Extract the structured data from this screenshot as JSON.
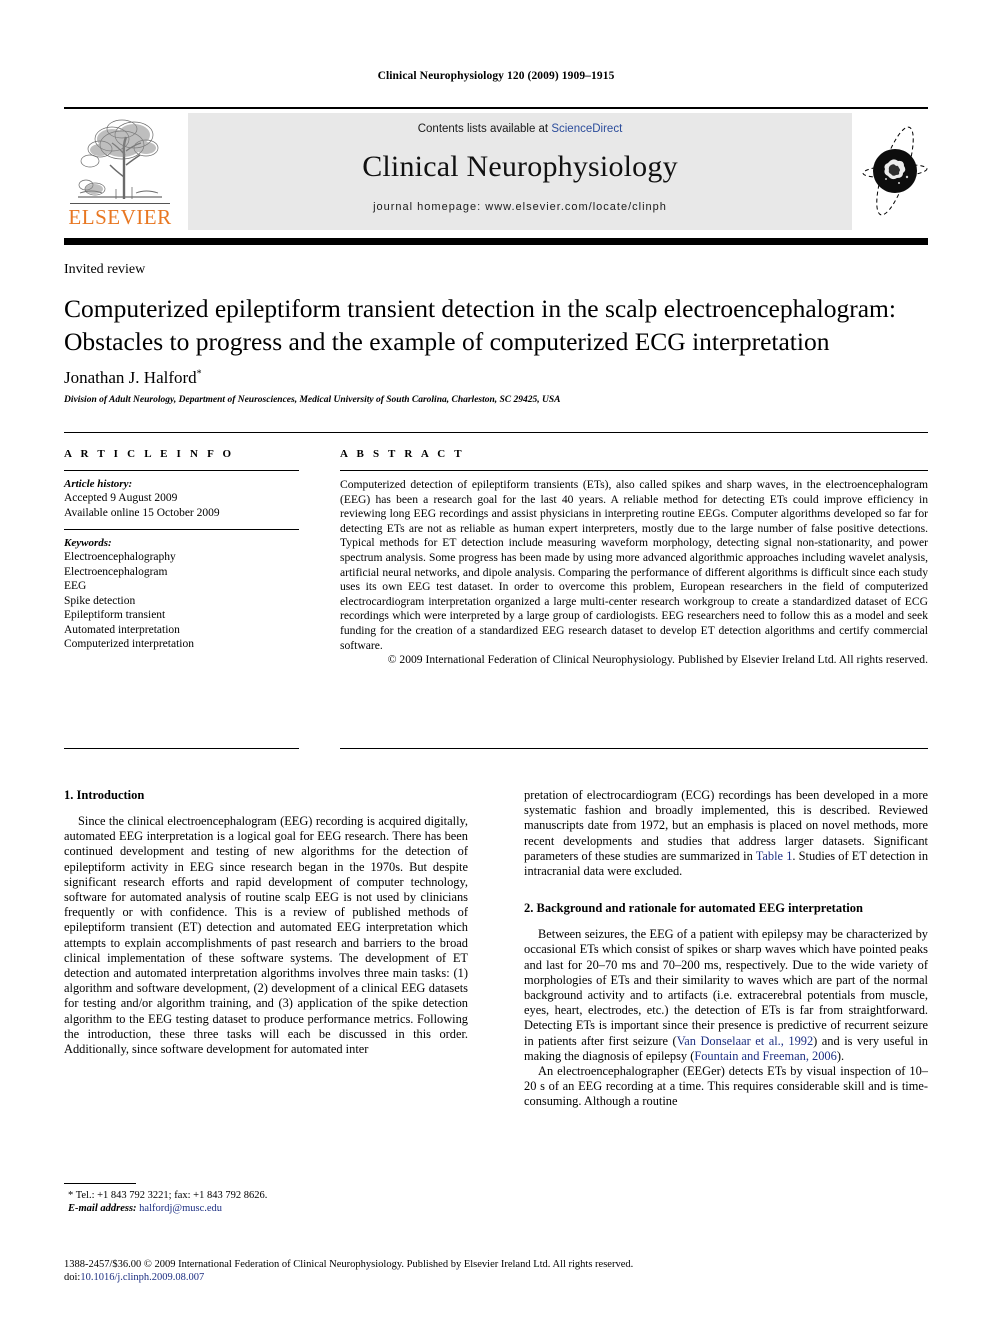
{
  "running_head": "Clinical Neurophysiology 120 (2009) 1909–1915",
  "masthead": {
    "contents_prefix": "Contents lists available at ",
    "sciencedirect_label": "ScienceDirect",
    "journal_title": "Clinical Neurophysiology",
    "homepage_line": "journal homepage: www.elsevier.com/locate/clinph",
    "elsevier_wordmark": "ELSEVIER",
    "tree_logo_name": "elsevier-tree-logo",
    "journal_mark_name": "clinical-neurophysiology-emblem",
    "sciencedirect_color": "#2b4c9b",
    "elsevier_orange": "#E87722",
    "header_box_bg": "#e8e8e8"
  },
  "article": {
    "type_label": "Invited review",
    "title": "Computerized epileptiform transient detection in the scalp electroencephalogram: Obstacles to progress and the example of computerized ECG interpretation",
    "author": "Jonathan J. Halford",
    "author_marker": "*",
    "affiliation": "Division of Adult Neurology, Department of Neurosciences, Medical University of South Carolina, Charleston, SC 29425, USA"
  },
  "info": {
    "heading": "A R T I C L E   I N F O",
    "history_label": "Article history:",
    "history_lines": [
      "Accepted 9 August 2009",
      "Available online 15 October 2009"
    ],
    "keywords_label": "Keywords:",
    "keywords": [
      "Electroencephalography",
      "Electroencephalogram",
      "EEG",
      "Spike detection",
      "Epileptiform transient",
      "Automated interpretation",
      "Computerized interpretation"
    ]
  },
  "abstract": {
    "heading": "A B S T R A C T",
    "body": "Computerized detection of epileptiform transients (ETs), also called spikes and sharp waves, in the electroencephalogram (EEG) has been a research goal for the last 40 years. A reliable method for detecting ETs could improve efficiency in reviewing long EEG recordings and assist physicians in interpreting routine EEGs. Computer algorithms developed so far for detecting ETs are not as reliable as human expert interpreters, mostly due to the large number of false positive detections. Typical methods for ET detection include measuring waveform morphology, detecting signal non-stationarity, and power spectrum analysis. Some progress has been made by using more advanced algorithmic approaches including wavelet analysis, artificial neural networks, and dipole analysis. Comparing the performance of different algorithms is difficult since each study uses its own EEG test dataset. In order to overcome this problem, European researchers in the field of computerized electrocardiogram interpretation organized a large multi-center research workgroup to create a standardized dataset of ECG recordings which were interpreted by a large group of cardiologists. EEG researchers need to follow this as a model and seek funding for the creation of a standardized EEG research dataset to develop ET detection algorithms and certify commercial software.",
    "copyright": "© 2009 International Federation of Clinical Neurophysiology. Published by Elsevier Ireland Ltd. All rights reserved."
  },
  "sections": {
    "intro_heading": "1. Introduction",
    "intro_par_1": "Since the clinical electroencephalogram (EEG) recording is acquired digitally, automated EEG interpretation is a logical goal for EEG research. There has been continued development and testing of new algorithms for the detection of epileptiform activity in EEG since research began in the 1970s. But despite significant research efforts and rapid development of computer technology, software for automated analysis of routine scalp EEG is not used by clinicians frequently or with confidence. This is a review of published methods of epileptiform transient (ET) detection and automated EEG interpretation which attempts to explain accomplishments of past research and barriers to the broad clinical implementation of these software systems. The development of ET detection and automated interpretation algorithms involves three main tasks: (1) algorithm and software development, (2) development of a clinical EEG datasets for testing and/or algorithm training, and (3) application of the spike detection algorithm to the EEG testing dataset to produce performance metrics. Following the introduction, these three tasks will each be discussed in this order. Additionally, since software development for automated inter",
    "intro_par_2_a": "pretation of electrocardiogram (ECG) recordings has been developed in a more systematic fashion and broadly implemented, this is described. Reviewed manuscripts date from 1972, but an emphasis is placed on novel methods, more recent developments and studies that address larger datasets. Significant parameters of these studies are summarized in ",
    "intro_table_link": "Table 1",
    "intro_par_2_b": ". Studies of ET detection in intracranial data were excluded.",
    "background_heading": "2. Background and rationale for automated EEG interpretation",
    "background_par_1_a": "Between seizures, the EEG of a patient with epilepsy may be characterized by occasional ETs which consist of spikes or sharp waves which have pointed peaks and last for 20–70 ms and 70–200 ms, respectively. Due to the wide variety of morphologies of ETs and their similarity to waves which are part of the normal background activity and to artifacts (i.e. extracerebral potentials from muscle, eyes, heart, electrodes, etc.) the detection of ETs is far from straightforward. Detecting ETs is important since their presence is predictive of recurrent seizure in patients after first seizure (",
    "background_cite_1": "Van Donselaar et al., 1992",
    "background_par_1_b": ") and is very useful in making the diagnosis of epilepsy (",
    "background_cite_2": "Fountain and Freeman, 2006",
    "background_par_1_c": ").",
    "background_par_2": "An electroencephalographer (EEGer) detects ETs by visual inspection of 10–20 s of an EEG recording at a time. This requires considerable skill and is time-consuming. Although a routine"
  },
  "footnote": {
    "marker": "*",
    "contact": "Tel.: +1 843 792 3221; fax: +1 843 792 8626.",
    "email_label": "E-mail address:",
    "email": "halfordj@musc.edu"
  },
  "footer": {
    "line1": "1388-2457/$36.00 © 2009 International Federation of Clinical Neurophysiology. Published by Elsevier Ireland Ltd. All rights reserved.",
    "doi_prefix": "doi:",
    "doi": "10.1016/j.clinph.2009.08.007"
  }
}
